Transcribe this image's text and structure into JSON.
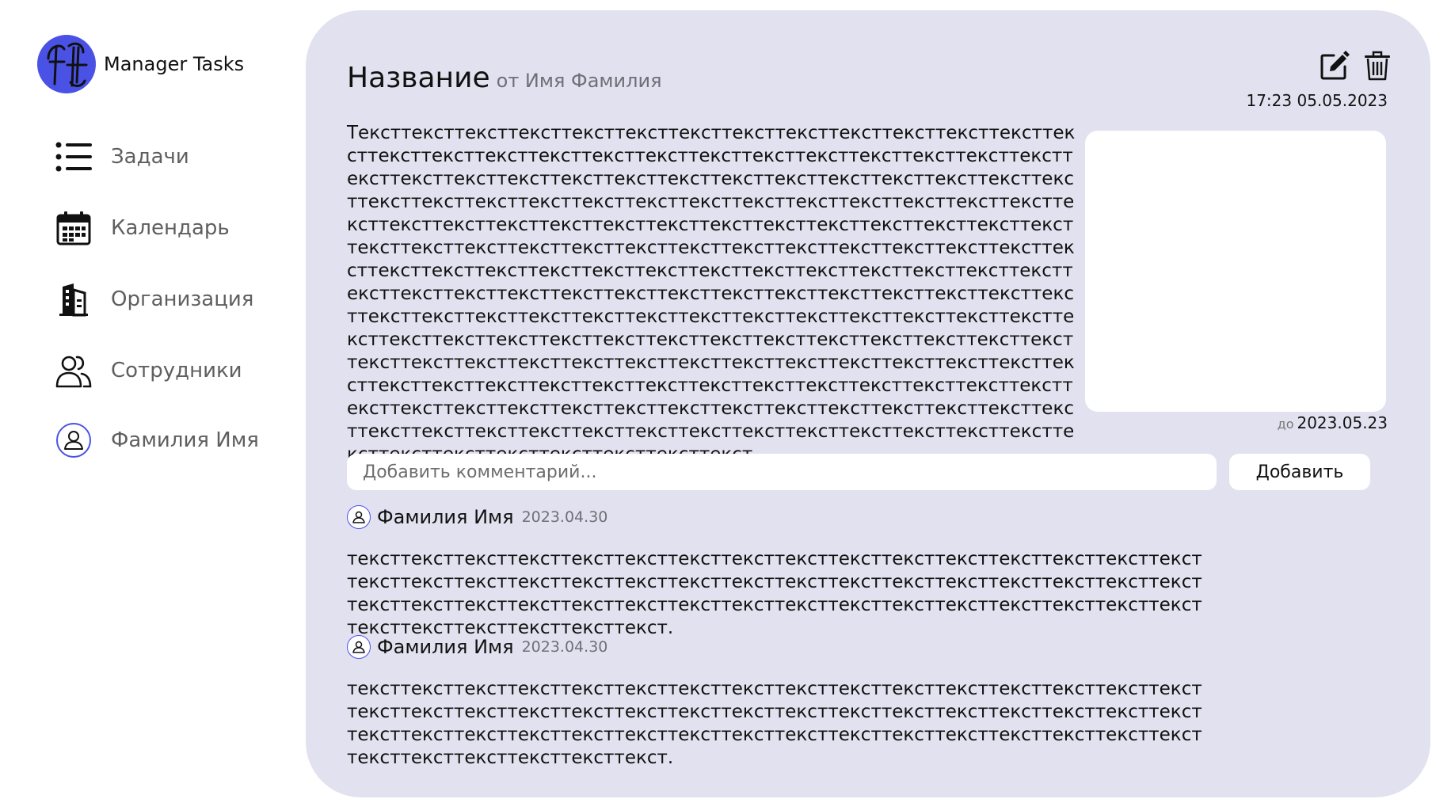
{
  "sidebar": {
    "app_name": "Manager Tasks",
    "items": [
      {
        "label": "Задачи",
        "icon": "list-icon"
      },
      {
        "label": "Календарь",
        "icon": "calendar-icon"
      },
      {
        "label": "Организация",
        "icon": "building-icon"
      },
      {
        "label": "Сотрудники",
        "icon": "users-icon"
      },
      {
        "label": "Фамилия Имя",
        "icon": "user-avatar-icon"
      }
    ]
  },
  "task": {
    "title": "Название",
    "author": "от Имя Фамилия",
    "created": "17:23 05.05.2023",
    "description": "Тексттексттексттексттексттексттексттексттексттексттексттексттексттексттексттексттексттексттексттексттексттексттексттексттексттексттексттексттексттексттексттексттексттексттексттексттексттексттексттексттексттексттексттексттексттексттексттексттексттексттексттексттексттексттексттексттексттексттексттексттексттексттексттексттексттексттексттексттексттексттексттексттексттексттексттексттексттексттексттексттексттексттексттексттексттексттексттексттексттексттексттексттексттексттексттексттексттексттексттексттексттексттексттексттексттексттексттексттексттексттексттексттексттексттексттексттексттексттексттексттексттексттексттексттексттексттексттексттексттексттексттексттексттексттексттексттексттексттексттексттексттексттексттексттексттексттексттексттексттексттексттексттексттексттексттексттексттексттексттексттексттексттексттексттексттексттексттексттексттексттексттексттексттексттексттексттексттексттексттексттексттексттексттексттексттексттексттексттексттексттексттексттексттексттексттексттексттекст",
    "deadline_prefix": "до",
    "deadline": "2023.05.23"
  },
  "comment_form": {
    "placeholder": "Добавить комментарий...",
    "button": "Добавить"
  },
  "comments": [
    {
      "author": "Фамилия Имя",
      "date": "2023.04.30",
      "text": "тексттексттексттексттексттексттексттексттексттексттексттексттексттексттексттексттексттексттексттексттексттексттексттексттексттексттексттексттексттексттексттексттексттексттексттексттексттексттексттексттексттексттексттексттексттексттексттексттексттексттексттексттексттекст."
    },
    {
      "author": "Фамилия Имя",
      "date": "2023.04.30",
      "text": "тексттексттексттексттексттексттексттексттексттексттексттексттексттексттексттексттексттексттексттексттексттексттексттексттексттексттексттексттексттексттексттексттексттексттексттексттексттексттексттексттексттексттексттексттексттексттексттексттексттексттексттексттексттекст."
    }
  ],
  "colors": {
    "accent": "#4a52e6",
    "panel": "#e2e1ef",
    "muted_text": "#5f5f5f"
  }
}
